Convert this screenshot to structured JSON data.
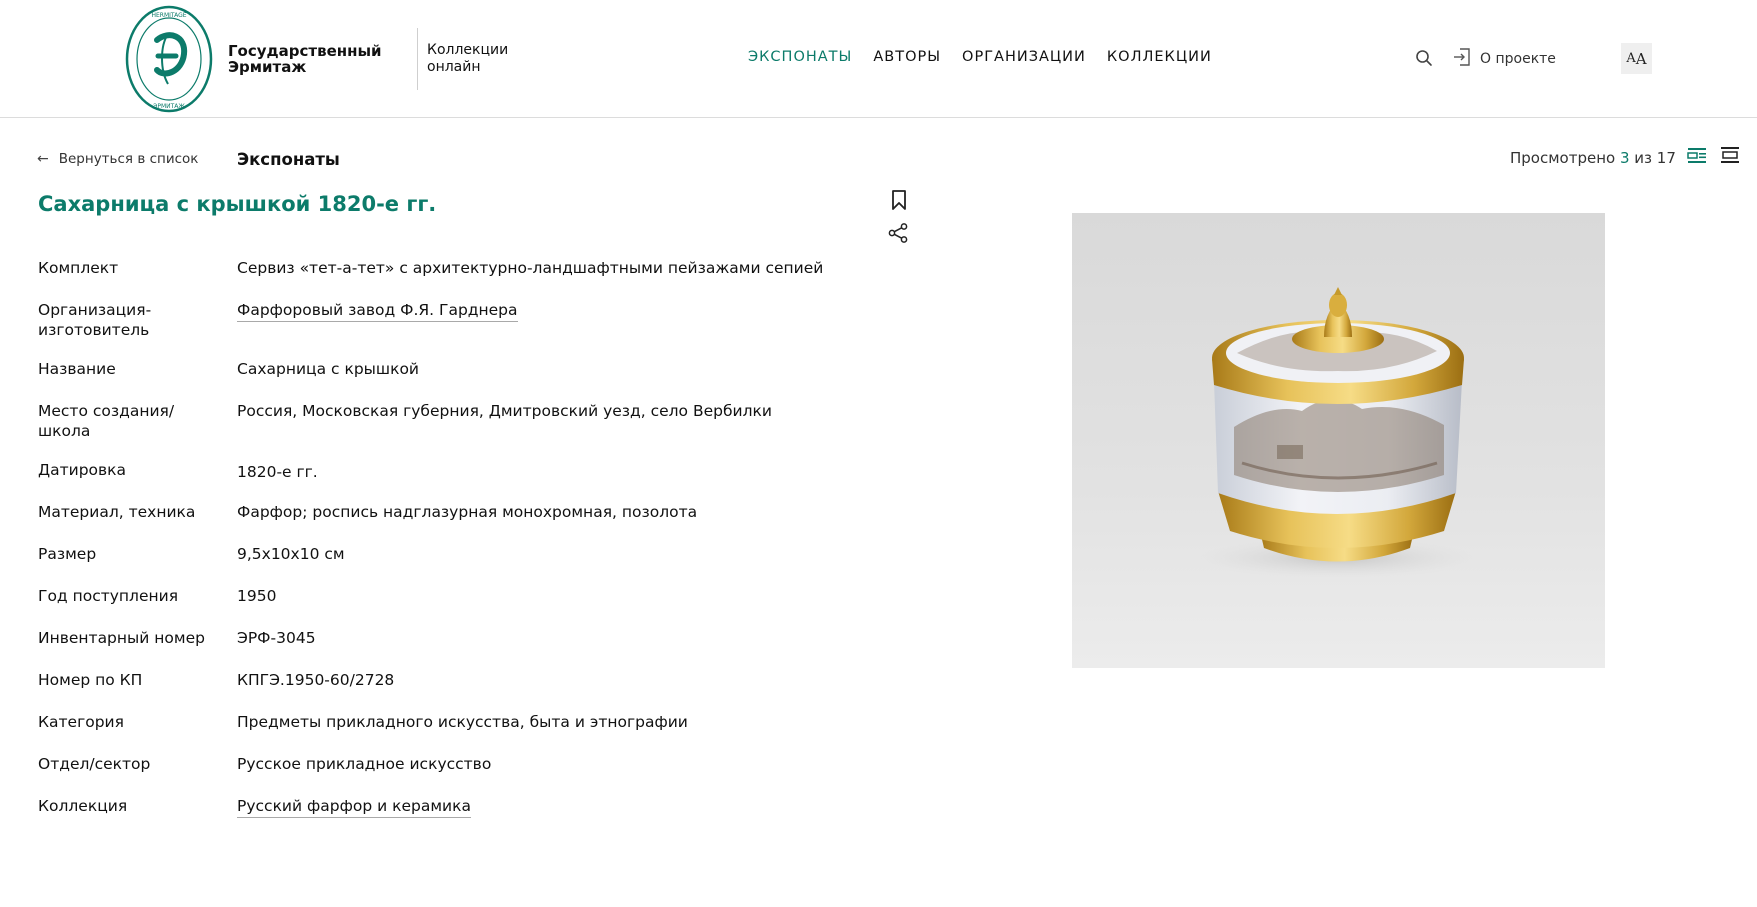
{
  "header": {
    "logo_text": "HERMITAGE ЭРМИТАЖ",
    "brand_line1": "Государственный",
    "brand_line2": "Эрмитаж",
    "sub_line1": "Коллекции",
    "sub_line2": "онлайн",
    "nav": [
      {
        "label": "ЭКСПОНАТЫ",
        "active": true
      },
      {
        "label": "АВТОРЫ",
        "active": false
      },
      {
        "label": "ОРГАНИЗАЦИИ",
        "active": false
      },
      {
        "label": "КОЛЛЕКЦИИ",
        "active": false
      }
    ],
    "search_icon": "search-icon",
    "about_label": "О проекте",
    "font_size_label_small": "A",
    "font_size_label_big": "A"
  },
  "subheader": {
    "back_label": "Вернуться в список",
    "section_title": "Экспонаты",
    "viewed_prefix": "Просмотрено ",
    "viewed_current": "3",
    "viewed_suffix": " из 17"
  },
  "item": {
    "title": "Сахарница с крышкой 1820-е гг.",
    "properties": [
      {
        "label": "Комплект",
        "value": "Сервиз «тет-а-тет» с архитектурно-ландшафтными пейзажами сепией",
        "link": false
      },
      {
        "label": "Организация-изготовитель",
        "value": "Фарфоровый завод Ф.Я. Гарднера",
        "link": true
      },
      {
        "label": "Название",
        "value": "Сахарница с крышкой",
        "link": false
      },
      {
        "label": "Место создания/школа",
        "value": "Россия, Московская губерния, Дмитровский уезд, село Вербилки",
        "link": false
      },
      {
        "label": "Датировка",
        "value": "1820-е гг.",
        "link": false
      },
      {
        "label": "Материал, техника",
        "value": "Фарфор; роспись надглазурная монохромная, позолота",
        "link": false
      },
      {
        "label": "Размер",
        "value": "9,5x10x10 см",
        "link": false
      },
      {
        "label": "Год поступления",
        "value": "1950",
        "link": false
      },
      {
        "label": "Инвентарный номер",
        "value": "ЭРФ-3045",
        "link": false
      },
      {
        "label": "Номер по КП",
        "value": "КПГЭ.1950-60/2728",
        "link": false
      },
      {
        "label": "Категория",
        "value": "Предметы прикладного искусства, быта и этнографии",
        "link": false
      },
      {
        "label": "Отдел/сектор",
        "value": "Русское прикладное искусство",
        "link": false
      },
      {
        "label": "Коллекция",
        "value": "Русский фарфор и керамика",
        "link": true
      }
    ]
  },
  "colors": {
    "accent": "#0c7b6a",
    "text": "#111111",
    "divider": "#dcdcdc"
  }
}
